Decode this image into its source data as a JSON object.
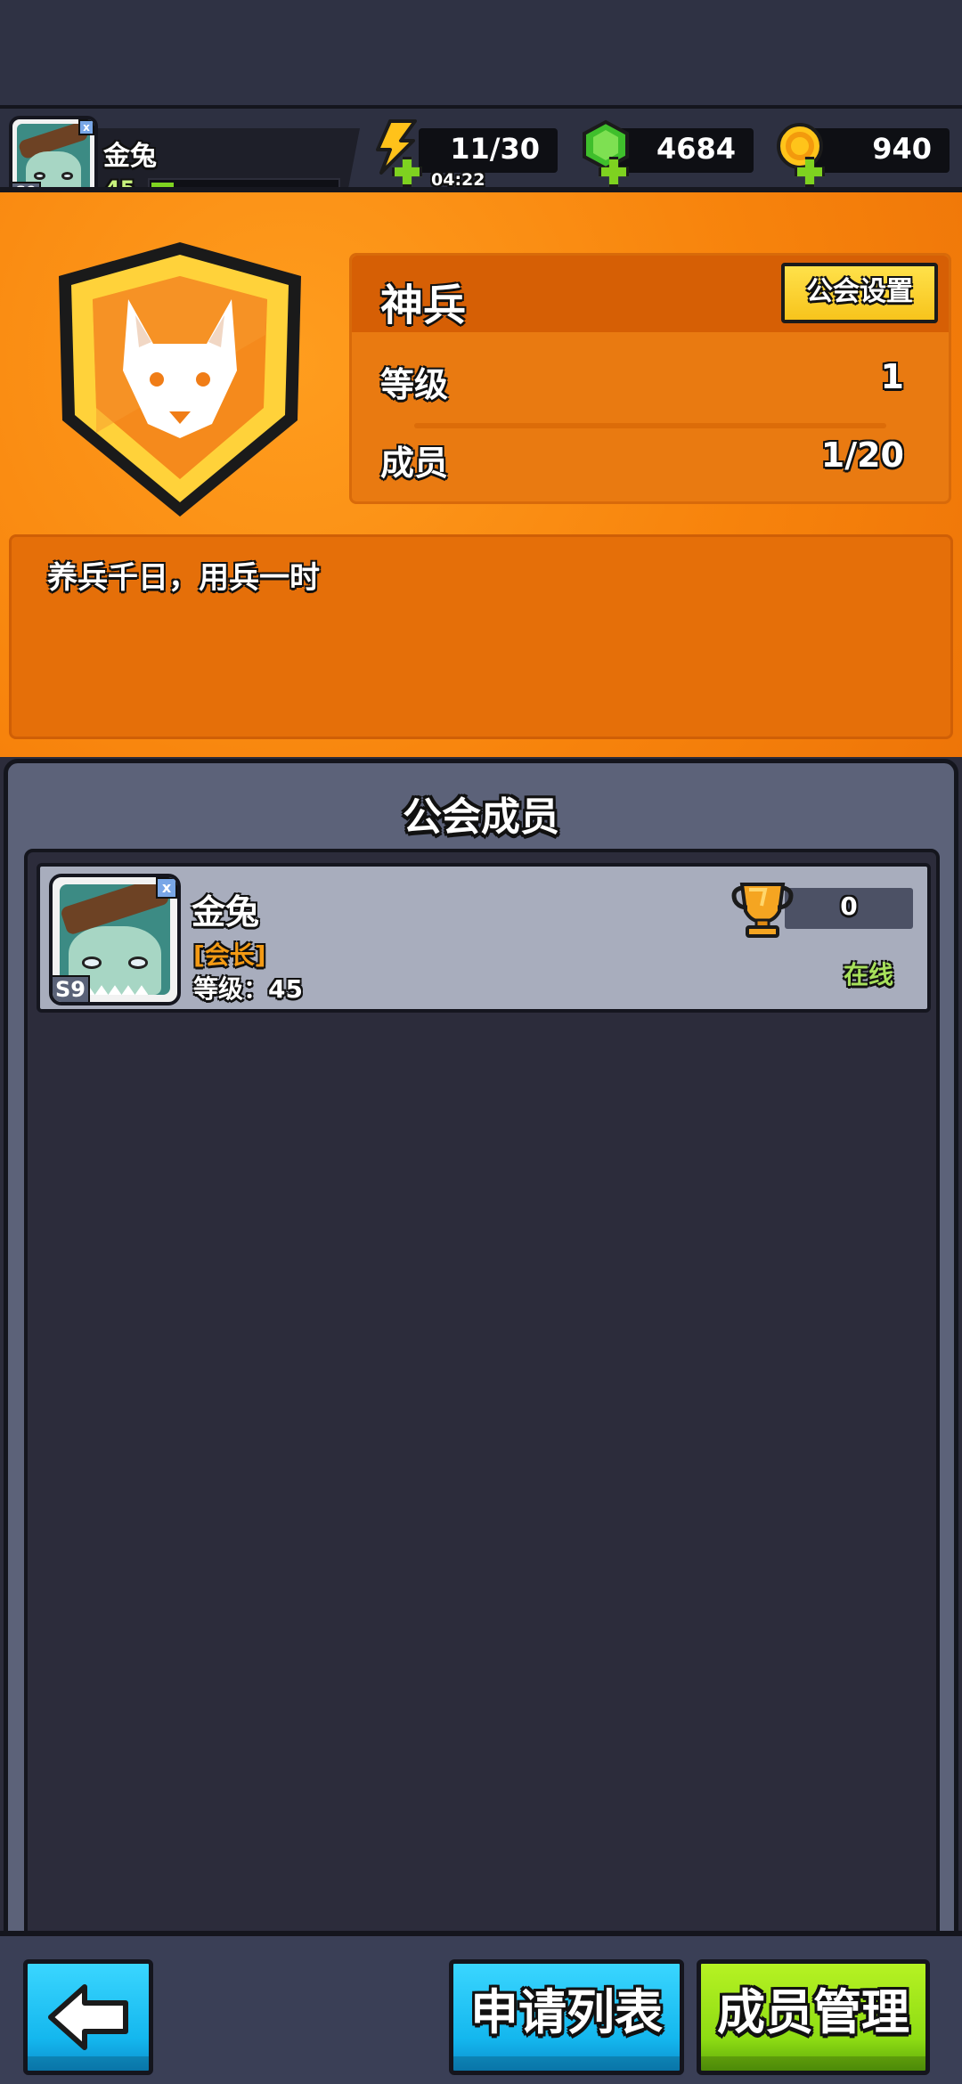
{
  "player": {
    "name": "金兔",
    "level": "45",
    "avatar_tag": "S9",
    "avatar_corner": "x",
    "xp_fraction": 0.12
  },
  "resources": {
    "energy": {
      "value": "11/30",
      "timer": "04:22",
      "icon": "lightning-icon"
    },
    "gems": {
      "value": "4684",
      "icon": "green-gem-icon"
    },
    "coins": {
      "value": "940",
      "icon": "gold-coin-icon"
    }
  },
  "guild": {
    "name": "神兵",
    "settings_label": "公会设置",
    "level_label": "等级",
    "level_value": "1",
    "members_label": "成员",
    "members_value": "1/20",
    "motto": "养兵千日，用兵一时",
    "emblem": "wolf-shield-emblem"
  },
  "members_panel": {
    "title": "公会成员",
    "members": [
      {
        "name": "金兔",
        "role": "[会长]",
        "level_text": "等级：45",
        "trophies": "0",
        "status": "在线",
        "avatar_tag": "S9",
        "avatar_corner": "x"
      }
    ]
  },
  "bottom_bar": {
    "back_icon": "left-arrow-icon",
    "apply_list_label": "申请列表",
    "member_manage_label": "成员管理"
  },
  "colors": {
    "banner_orange": "#f7830c",
    "accent_yellow": "#f7c41c",
    "button_blue": "#14b7ee",
    "button_green": "#8edc13",
    "online_green": "#a7e05b",
    "role_orange": "#f39a14"
  }
}
